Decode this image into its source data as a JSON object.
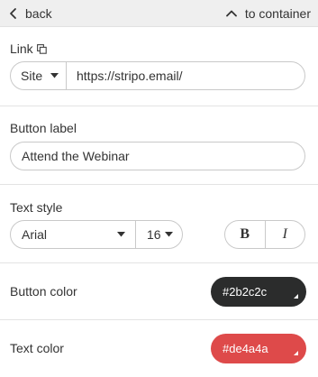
{
  "topbar": {
    "back_label": "back",
    "container_label": "to container"
  },
  "link": {
    "label": "Link",
    "type_value": "Site",
    "url_value": "https://stripo.email/"
  },
  "button_label": {
    "label": "Button label",
    "value": "Attend the Webinar"
  },
  "text_style": {
    "label": "Text style",
    "font_family": "Arial",
    "font_size": "16",
    "bold_label": "B",
    "italic_label": "I"
  },
  "button_color": {
    "label": "Button color",
    "value": "#2b2c2c",
    "color": "#2b2c2c"
  },
  "text_color": {
    "label": "Text color",
    "value": "#de4a4a",
    "color": "#de4a4a"
  }
}
